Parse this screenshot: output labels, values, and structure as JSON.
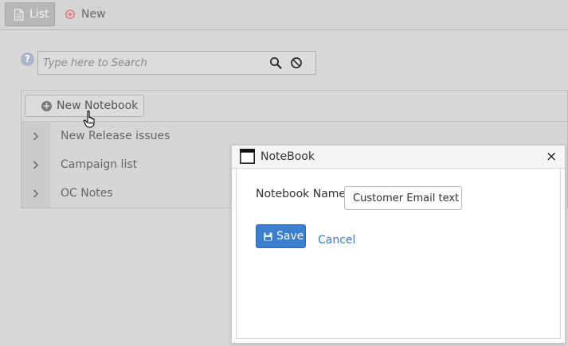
{
  "toolbar": {
    "list_label": "List",
    "new_label": "New"
  },
  "search": {
    "placeholder": "Type here to Search",
    "help_glyph": "?"
  },
  "panel": {
    "new_notebook_label": "New Notebook",
    "rows": [
      {
        "label": "New Release issues"
      },
      {
        "label": "Campaign list"
      },
      {
        "label": "OC Notes"
      }
    ]
  },
  "dialog": {
    "title": "NoteBook",
    "close_glyph": "×",
    "field_label": "Notebook Name",
    "field_value": "Customer Email text",
    "save_label": "Save",
    "cancel_label": "Cancel"
  },
  "colors": {
    "accent": "#3a7fd0",
    "link": "#3c78c2",
    "new_icon": "#e0726f"
  },
  "icons": [
    "document-icon",
    "plus-circle-icon",
    "help-icon",
    "search-icon",
    "clear-icon",
    "chevron-right-icon",
    "window-icon",
    "close-icon",
    "floppy-disk-icon",
    "hand-cursor-icon"
  ]
}
